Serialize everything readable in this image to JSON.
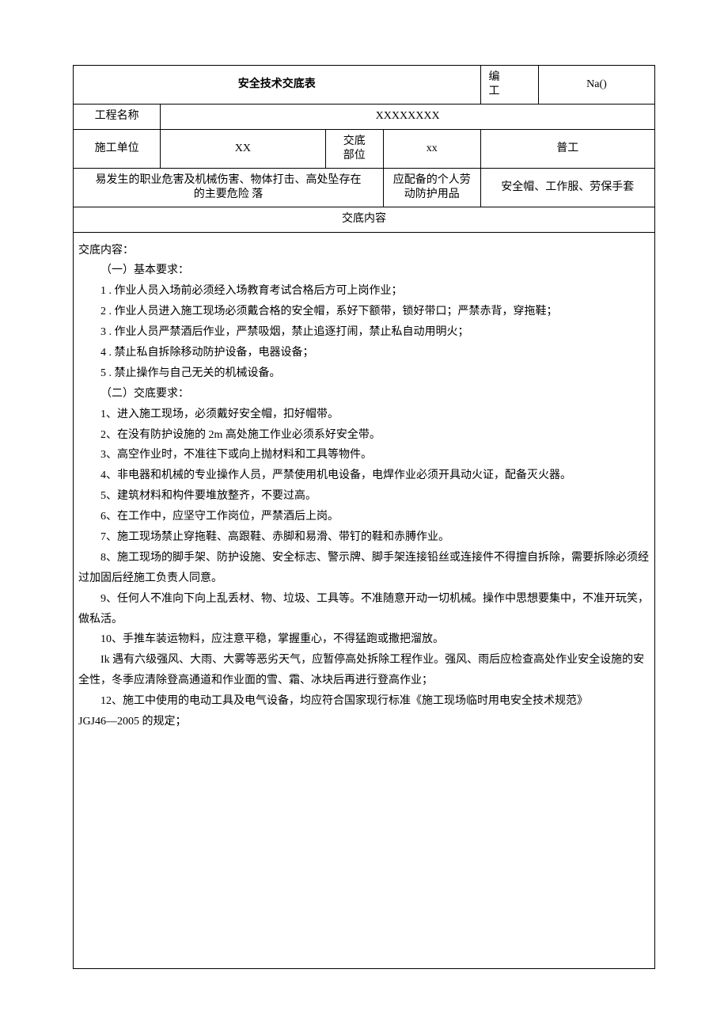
{
  "table": {
    "title": "安全技术交底表",
    "code_label": "编\n工",
    "code_value": "Na()",
    "project_label": "工程名称",
    "project_value": "XXXXXXXX",
    "unit_label": "施工单位",
    "unit_value": "XX",
    "part_label": "交底\n部位",
    "part_value": "xx",
    "job_value": "普工",
    "hazard_label": "易发生的职业危害及机械伤害、物体打击、高处坠存在\n的主要危险                                    落",
    "ppe_label": "应配备的个人劳\n动防护用品",
    "ppe_value": "安全帽、工作服、劳保手套",
    "content_header": "交底内容"
  },
  "content": {
    "section_title": "交底内容：",
    "sub1_title": "（一）基本要求：",
    "sub1_items": [
      "1 . 作业人员入场前必须经入场教育考试合格后方可上岗作业；",
      "2 . 作业人员进入施工现场必须戴合格的安全帽，系好下额带，锁好带口；严禁赤背，穿拖鞋；",
      "3 . 作业人员严禁酒后作业，严禁吸烟，禁止追逐打闹，禁止私自动用明火；",
      "4 . 禁止私自拆除移动防护设备，电器设备；",
      "5 . 禁止操作与自己无关的机械设备。"
    ],
    "sub2_title": "（二）交底要求：",
    "sub2_items": [
      "1、进入施工现场，必须戴好安全帽，扣好帽带。",
      "2、在没有防护设施的 2m 高处施工作业必须系好安全带。",
      "3、高空作业时，不准往下或向上抛材料和工具等物件。",
      "4、非电器和机械的专业操作人员，严禁使用机电设备，电焊作业必须开具动火证，配备灭火器。",
      "5、建筑材料和构件要堆放整齐，不要过高。",
      "6、在工作中，应坚守工作岗位，严禁酒后上岗。",
      "7、施工现场禁止穿拖鞋、高跟鞋、赤脚和易滑、带钉的鞋和赤膊作业。"
    ],
    "p8": "8、施工现场的脚手架、防护设施、安全标志、警示牌、脚手架连接铅丝或连接件不得擅自拆除，需要拆除必须经过加固后经施工负责人同意。",
    "p9": "9、任何人不准向下向上乱丢材、物、垃圾、工具等。不准随意开动一切机械。操作中思想要集中，不准开玩笑，做私活。",
    "p10": "10、手推车装运物料，应注意平稳，掌握重心，不得猛跑或撒把溜放。",
    "p11": "Ik 遇有六级强风、大雨、大雾等恶劣天气，应暂停高处拆除工程作业。强风、雨后应检查高处作业安全设施的安全性，冬季应清除登高通道和作业面的雪、霜、冰块后再进行登高作业；",
    "p12a": "12、施工中使用的电动工具及电气设备，均应符合国家现行标准《施工现场临时用电安全技术规范》",
    "p12b": "JGJ46—2005 的规定；"
  }
}
